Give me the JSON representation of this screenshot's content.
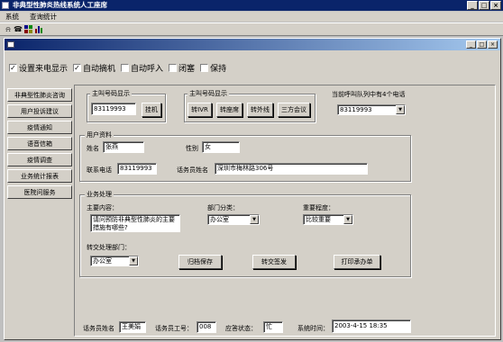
{
  "window": {
    "title": "非典型性肺炎热线系统人工座席",
    "min": "_",
    "max": "□",
    "close": "×"
  },
  "menu": [
    "系统",
    "查询统计"
  ],
  "options": [
    {
      "label": "设置来电显示",
      "checked": true
    },
    {
      "label": "自动摘机",
      "checked": true
    },
    {
      "label": "自动呼入",
      "checked": false
    },
    {
      "label": "闭塞",
      "checked": false
    },
    {
      "label": "保持",
      "checked": false
    }
  ],
  "sidebar": [
    "非典型性肺炎咨询",
    "用户投诉建议",
    "疫情通知",
    "语音信箱",
    "疫情调查",
    "业务统计报表",
    "医院问服务"
  ],
  "caller_group": {
    "title": "主叫号码显示",
    "number": "83119993",
    "button": "挂机"
  },
  "called_group": {
    "title": "主叫号码显示",
    "buttons": [
      "转IVR",
      "转座席",
      "转外线",
      "三方会议"
    ]
  },
  "queue": {
    "label": "当前呼叫队列中有4个电话",
    "selected": "83119993"
  },
  "user": {
    "title": "用户资料",
    "name_label": "姓名",
    "name": "张燕",
    "gender_label": "性别",
    "gender": "女",
    "phone_label": "联系电话",
    "phone": "83119993",
    "address_label": "话务员姓名",
    "address": "深圳市梅林路306号"
  },
  "business": {
    "title": "业务处理",
    "content_label": "主要内容：",
    "content": "请问预防非典型性肺炎的主要措施有哪些?",
    "dept_label": "部门分类：",
    "dept": "办公室",
    "importance_label": "重要程度：",
    "importance": "比较重要",
    "transfer_label": "转交处理部门：",
    "transfer": "办公室",
    "buttons": [
      "归档保存",
      "转交签发",
      "打印承办单"
    ]
  },
  "status": {
    "operator_label": "话务员姓名",
    "operator": "王美娟",
    "id_label": "话务员工号：",
    "id": "008",
    "state_label": "应答状态：",
    "state": "忙",
    "time_label": "系统时间：",
    "time": "2003-4-15 18:35"
  },
  "colors": {
    "titlebar": "#0a246a",
    "face": "#d4d0c8",
    "workspace": "#c0c0c0"
  }
}
